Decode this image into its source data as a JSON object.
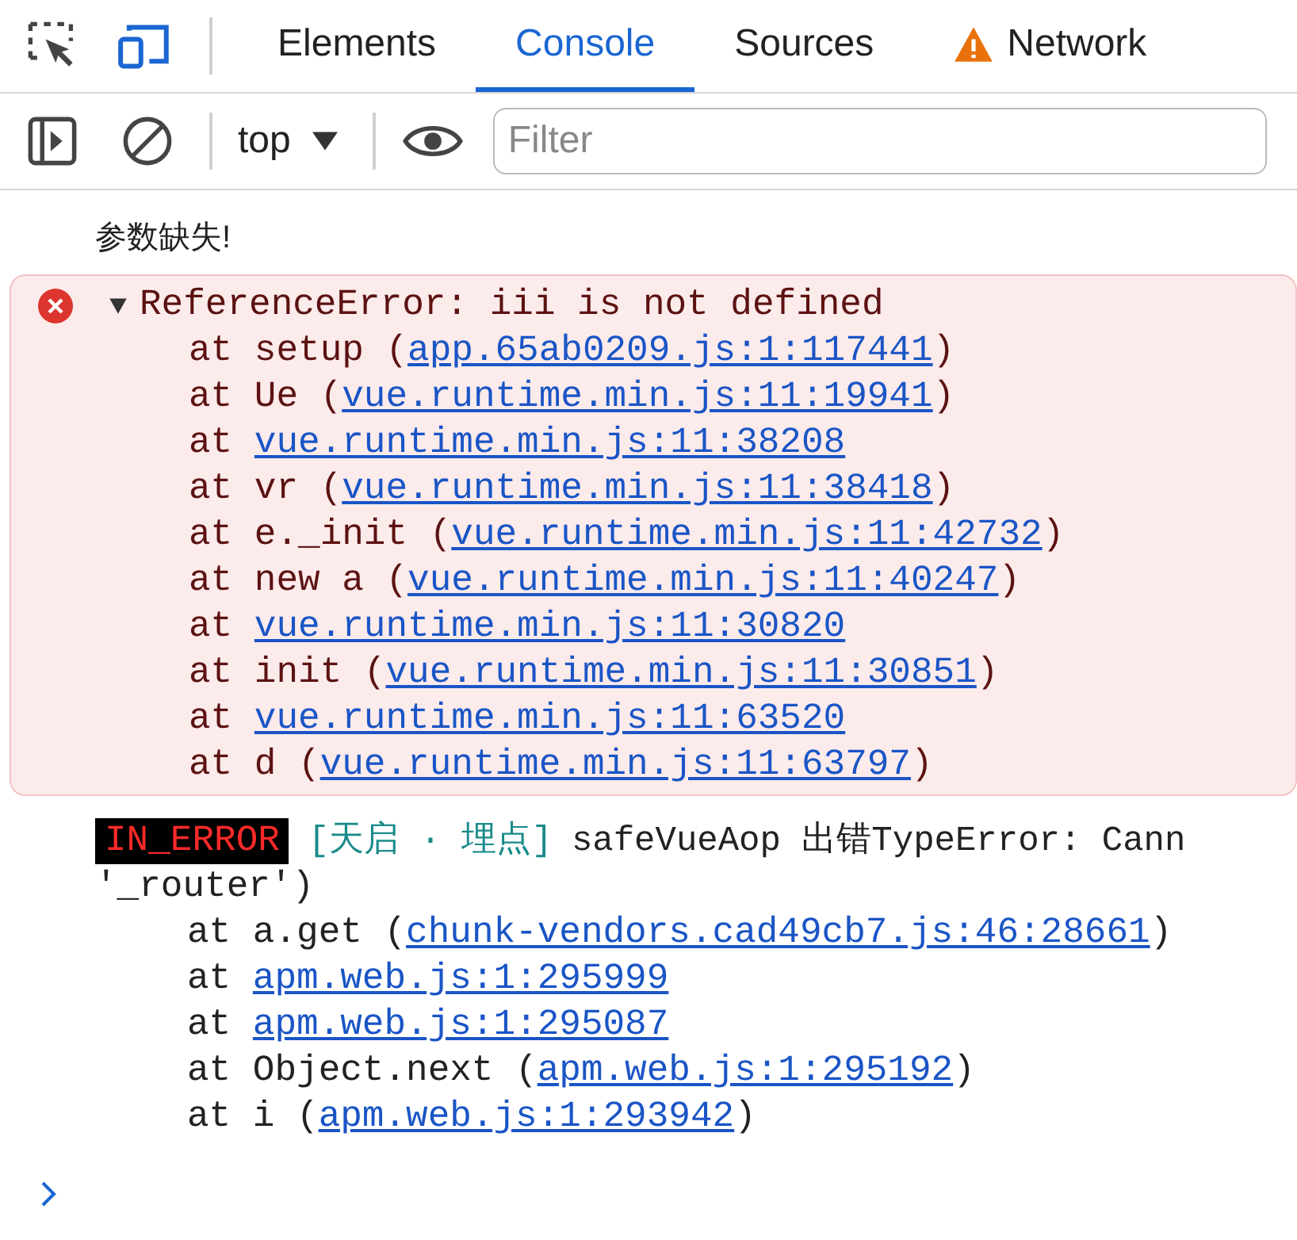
{
  "tabs": [
    {
      "label": "Elements",
      "selected": false,
      "warning": false
    },
    {
      "label": "Console",
      "selected": true,
      "warning": false
    },
    {
      "label": "Sources",
      "selected": false,
      "warning": false
    },
    {
      "label": "Network",
      "selected": false,
      "warning": true
    }
  ],
  "toolbar": {
    "context": "top",
    "filter_placeholder": "Filter"
  },
  "messages": [
    {
      "kind": "log",
      "text": "参数缺失!"
    },
    {
      "kind": "error",
      "expanded": true,
      "title": "ReferenceError: iii is not defined",
      "stack": [
        {
          "before": "at setup (",
          "link": "app.65ab0209.js:1:117441",
          "after": ")"
        },
        {
          "before": "at Ue (",
          "link": "vue.runtime.min.js:11:19941",
          "after": ")"
        },
        {
          "before": "at ",
          "link": "vue.runtime.min.js:11:38208"
        },
        {
          "before": "at vr (",
          "link": "vue.runtime.min.js:11:38418",
          "after": ")"
        },
        {
          "before": "at e._init (",
          "link": "vue.runtime.min.js:11:42732",
          "after": ")"
        },
        {
          "before": "at new a (",
          "link": "vue.runtime.min.js:11:40247",
          "after": ")"
        },
        {
          "before": "at ",
          "link": "vue.runtime.min.js:11:30820"
        },
        {
          "before": "at init (",
          "link": "vue.runtime.min.js:11:30851",
          "after": ")"
        },
        {
          "before": "at ",
          "link": "vue.runtime.min.js:11:63520"
        },
        {
          "before": "at d (",
          "link": "vue.runtime.min.js:11:63797",
          "after": ")"
        }
      ]
    },
    {
      "kind": "tagged",
      "badge": "IN_ERROR",
      "tag": "[天启 · 埋点]",
      "text": "safeVueAop 出错TypeError: Cann",
      "continuation": "'_router')",
      "stack": [
        {
          "before": "at a.get (",
          "link": "chunk-vendors.cad49cb7.js:46:28661",
          "after": ")"
        },
        {
          "before": "at ",
          "link": "apm.web.js:1:295999"
        },
        {
          "before": "at ",
          "link": "apm.web.js:1:295087"
        },
        {
          "before": "at Object.next (",
          "link": "apm.web.js:1:295192",
          "after": ")"
        },
        {
          "before": "at i (",
          "link": "apm.web.js:1:293942",
          "after": ")"
        }
      ]
    }
  ]
}
